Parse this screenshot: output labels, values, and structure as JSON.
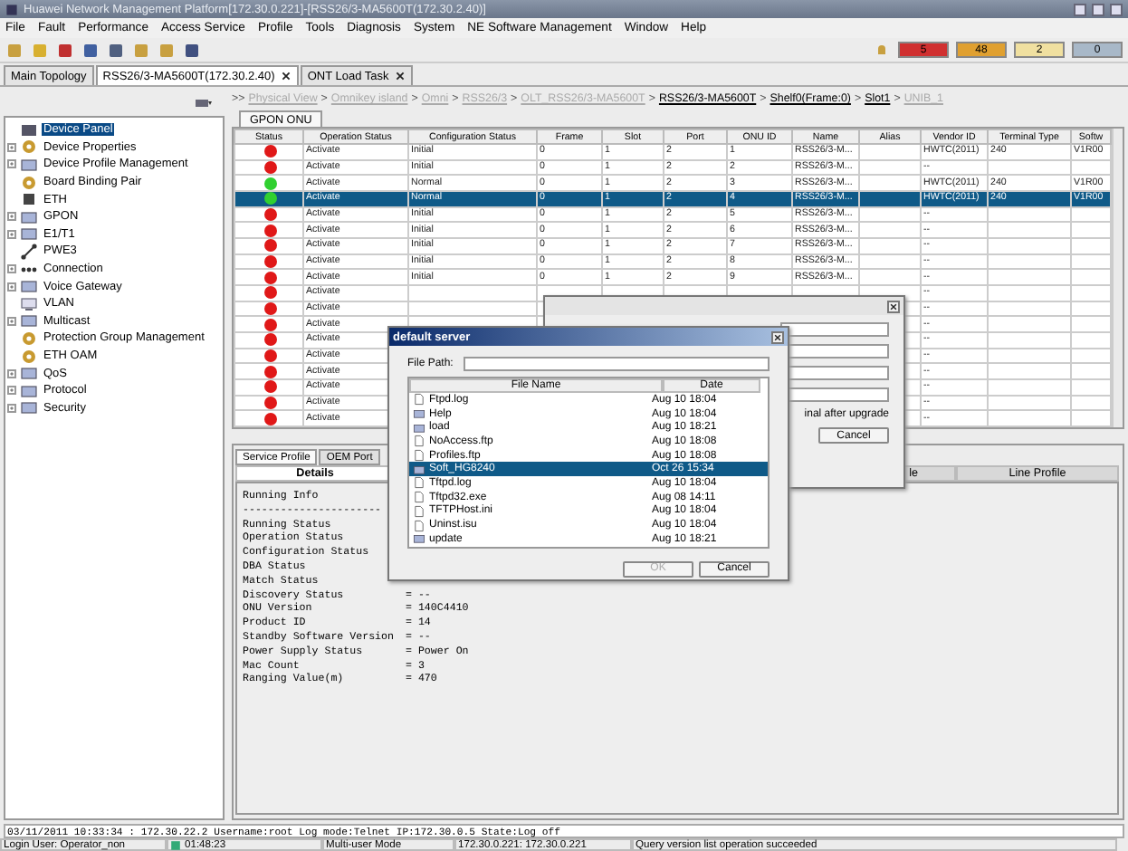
{
  "window": {
    "title": "Huawei Network Management Platform[172.30.0.221]-[RSS26/3-MA5600T(172.30.2.40)]"
  },
  "menu": [
    "File",
    "Fault",
    "Performance",
    "Access Service",
    "Profile",
    "Tools",
    "Diagnosis",
    "System",
    "NE Software Management",
    "Window",
    "Help"
  ],
  "alarms": [
    {
      "count": "5",
      "color": "#d03030"
    },
    {
      "count": "48",
      "color": "#e0a030"
    },
    {
      "count": "2",
      "color": "#f0e0a0"
    },
    {
      "count": "0",
      "color": "#a8b8c8"
    }
  ],
  "tabs": [
    {
      "label": "Main Topology",
      "selected": false,
      "closable": false
    },
    {
      "label": "RSS26/3-MA5600T(172.30.2.40)",
      "selected": true,
      "closable": true
    },
    {
      "label": "ONT Load Task",
      "selected": false,
      "closable": true
    }
  ],
  "tree": [
    {
      "label": "Device Panel",
      "kind": "panel",
      "selected": true
    },
    {
      "label": "Device Properties",
      "kind": "gear",
      "selected": false,
      "expanded": false
    },
    {
      "label": "Device Profile Management",
      "kind": "folder",
      "selected": false,
      "expanded": false
    },
    {
      "label": "Board Binding Pair",
      "kind": "gear",
      "selected": false
    },
    {
      "label": "ETH",
      "kind": "port",
      "selected": false
    },
    {
      "label": "GPON",
      "kind": "folder",
      "selected": false,
      "expanded": false
    },
    {
      "label": "E1/T1",
      "kind": "folder",
      "selected": false,
      "expanded": false
    },
    {
      "label": "PWE3",
      "kind": "link",
      "selected": false
    },
    {
      "label": "Connection",
      "kind": "dots",
      "selected": false,
      "expanded": false
    },
    {
      "label": "Voice Gateway",
      "kind": "folder",
      "selected": false,
      "expanded": false
    },
    {
      "label": "VLAN",
      "kind": "screen",
      "selected": false
    },
    {
      "label": "Multicast",
      "kind": "folder",
      "selected": false,
      "expanded": false
    },
    {
      "label": "Protection Group Management",
      "kind": "gear",
      "selected": false
    },
    {
      "label": "ETH OAM",
      "kind": "gear",
      "selected": false
    },
    {
      "label": "QoS",
      "kind": "folder",
      "selected": false,
      "expanded": false
    },
    {
      "label": "Protocol",
      "kind": "folder",
      "selected": false,
      "expanded": false
    },
    {
      "label": "Security",
      "kind": "folder",
      "selected": false,
      "expanded": false
    }
  ],
  "breadcrumb": [
    {
      "prefix": ">>",
      "label": "Physical View",
      "disabled": true
    },
    {
      "prefix": ">",
      "label": "Omnikey island",
      "disabled": true
    },
    {
      "prefix": ">",
      "label": "Omni",
      "disabled": true
    },
    {
      "prefix": ">",
      "label": "RSS26/3",
      "disabled": true
    },
    {
      "prefix": ">",
      "label": "OLT_RSS26/3-MA5600T",
      "disabled": true
    },
    {
      "prefix": ">",
      "label": "RSS26/3-MA5600T",
      "disabled": false
    },
    {
      "prefix": ">",
      "label": "Shelf0(Frame:0)",
      "disabled": false
    },
    {
      "prefix": ">",
      "label": "Slot1",
      "disabled": false
    },
    {
      "prefix": ">",
      "label": "UNIB_1",
      "disabled": true
    }
  ],
  "view_tab": {
    "label": "GPON ONU",
    "selected": true
  },
  "table": {
    "columns": [
      "Status",
      "Operation Status",
      "Configuration Status",
      "Frame",
      "Slot",
      "Port",
      "ONU ID",
      "Name",
      "Alias",
      "Vendor ID",
      "Terminal Type",
      "Softw"
    ],
    "rows": [
      {
        "color": "#e01818",
        "selected": false,
        "cells": {
          "1": "Activate",
          "2": "Initial",
          "3": "0",
          "4": "1",
          "5": "2",
          "6": "1",
          "7": "RSS26/3-M...",
          "9": "HWTC(2011)",
          "10": "240",
          "11": "V1R00"
        }
      },
      {
        "color": "#e01818",
        "selected": false,
        "cells": {
          "1": "Activate",
          "2": "Initial",
          "3": "0",
          "4": "1",
          "5": "2",
          "6": "2",
          "7": "RSS26/3-M...",
          "9": "--"
        }
      },
      {
        "color": "#30d030",
        "selected": false,
        "cells": {
          "1": "Activate",
          "2": "Normal",
          "3": "0",
          "4": "1",
          "5": "2",
          "6": "3",
          "7": "RSS26/3-M...",
          "9": "HWTC(2011)",
          "10": "240",
          "11": "V1R00"
        }
      },
      {
        "color": "#30d030",
        "selected": true,
        "cells": {
          "1": "Activate",
          "2": "Normal",
          "3": "0",
          "4": "1",
          "5": "2",
          "6": "4",
          "7": "RSS26/3-M...",
          "9": "HWTC(2011)",
          "10": "240",
          "11": "V1R00"
        }
      },
      {
        "color": "#e01818",
        "selected": false,
        "cells": {
          "1": "Activate",
          "2": "Initial",
          "3": "0",
          "4": "1",
          "5": "2",
          "6": "5",
          "7": "RSS26/3-M...",
          "9": "--"
        }
      },
      {
        "color": "#e01818",
        "selected": false,
        "cells": {
          "1": "Activate",
          "2": "Initial",
          "3": "0",
          "4": "1",
          "5": "2",
          "6": "6",
          "7": "RSS26/3-M...",
          "9": "--"
        }
      },
      {
        "color": "#e01818",
        "selected": false,
        "cells": {
          "1": "Activate",
          "2": "Initial",
          "3": "0",
          "4": "1",
          "5": "2",
          "6": "7",
          "7": "RSS26/3-M...",
          "9": "--"
        }
      },
      {
        "color": "#e01818",
        "selected": false,
        "cells": {
          "1": "Activate",
          "2": "Initial",
          "3": "0",
          "4": "1",
          "5": "2",
          "6": "8",
          "7": "RSS26/3-M...",
          "9": "--"
        }
      },
      {
        "color": "#e01818",
        "selected": false,
        "cells": {
          "1": "Activate",
          "2": "Initial",
          "3": "0",
          "4": "1",
          "5": "2",
          "6": "9",
          "7": "RSS26/3-M...",
          "9": "--"
        }
      },
      {
        "color": "#e01818",
        "selected": false,
        "cells": {
          "1": "Activate",
          "9": "--"
        }
      },
      {
        "color": "#e01818",
        "selected": false,
        "cells": {
          "1": "Activate",
          "9": "--"
        }
      },
      {
        "color": "#e01818",
        "selected": false,
        "cells": {
          "1": "Activate",
          "9": "--"
        }
      },
      {
        "color": "#e01818",
        "selected": false,
        "cells": {
          "1": "Activate",
          "9": "--"
        }
      },
      {
        "color": "#e01818",
        "selected": false,
        "cells": {
          "1": "Activate",
          "9": "--"
        }
      },
      {
        "color": "#e01818",
        "selected": false,
        "cells": {
          "1": "Activate",
          "9": "--"
        }
      },
      {
        "color": "#e01818",
        "selected": false,
        "cells": {
          "1": "Activate",
          "9": "--"
        }
      },
      {
        "color": "#e01818",
        "selected": false,
        "cells": {
          "1": "Activate",
          "9": "--"
        }
      },
      {
        "color": "#e01818",
        "selected": false,
        "cells": {
          "1": "Activate",
          "9": "--"
        }
      }
    ]
  },
  "lower_tabs": [
    {
      "label": "Service Profile",
      "selected": true
    },
    {
      "label": "OEM Port",
      "selected": false
    }
  ],
  "sub_tabs": [
    {
      "label": "Details",
      "selected": true
    },
    {
      "label": "le",
      "selected": false
    },
    {
      "label": "Line Profile",
      "selected": false
    }
  ],
  "details": {
    "heading": "Running Info",
    "rule": "----------------------",
    "lines": [
      {
        "label": "Running Status"
      },
      {
        "label": "Operation Status"
      },
      {
        "label": "Configuration Status"
      },
      {
        "label": "DBA Status"
      },
      {
        "label": "Match Status"
      },
      {
        "label": "Discovery Status",
        "value": "= --"
      },
      {
        "label": "ONU Version",
        "value": "= 140C4410"
      },
      {
        "label": "Product ID",
        "value": "= 14"
      },
      {
        "label": "Standby Software Version",
        "value": "= --"
      },
      {
        "label": "Power Supply Status",
        "value": "= Power On"
      },
      {
        "label": "Mac Count",
        "value": "= 3"
      },
      {
        "label": "Ranging Value(m)",
        "value": "= 470"
      }
    ]
  },
  "upgrade_dialog": {
    "option_text": "inal after upgrade",
    "cancel": "Cancel"
  },
  "server_dialog": {
    "title": "default server",
    "file_path_label": "File Path:",
    "columns": [
      "File Name",
      "Date"
    ],
    "files": [
      {
        "name": "Ftpd.log",
        "date": "Aug 10 18:04",
        "kind": "file",
        "selected": false
      },
      {
        "name": "Help",
        "date": "Aug 10 18:04",
        "kind": "folder",
        "selected": false
      },
      {
        "name": "load",
        "date": "Aug 10 18:21",
        "kind": "folder",
        "selected": false
      },
      {
        "name": "NoAccess.ftp",
        "date": "Aug 10 18:08",
        "kind": "file",
        "selected": false
      },
      {
        "name": "Profiles.ftp",
        "date": "Aug 10 18:08",
        "kind": "file",
        "selected": false
      },
      {
        "name": "Soft_HG8240",
        "date": "Oct 26 15:34",
        "kind": "folder",
        "selected": true
      },
      {
        "name": "Tftpd.log",
        "date": "Aug 10 18:04",
        "kind": "file",
        "selected": false
      },
      {
        "name": "Tftpd32.exe",
        "date": "Aug 08 14:11",
        "kind": "file",
        "selected": false
      },
      {
        "name": "TFTPHost.ini",
        "date": "Aug 10 18:04",
        "kind": "file",
        "selected": false
      },
      {
        "name": "Uninst.isu",
        "date": "Aug 10 18:04",
        "kind": "file",
        "selected": false
      },
      {
        "name": "update",
        "date": "Aug 10 18:21",
        "kind": "folder",
        "selected": false
      }
    ],
    "buttons": [
      {
        "label": "OK",
        "disabled": true
      },
      {
        "label": "Cancel",
        "disabled": false
      }
    ]
  },
  "log_line": "03/11/2011 10:33:34 : 172.30.22.2  Username:root Log mode:Telnet IP:172.30.0.5 State:Log off",
  "status_bar": {
    "user": "Login User: Operator_non",
    "time": "01:48:23",
    "mode": "Multi-user Mode",
    "servers": "172.30.0.221: 172.30.0.221",
    "message": "Query version list operation succeeded"
  }
}
